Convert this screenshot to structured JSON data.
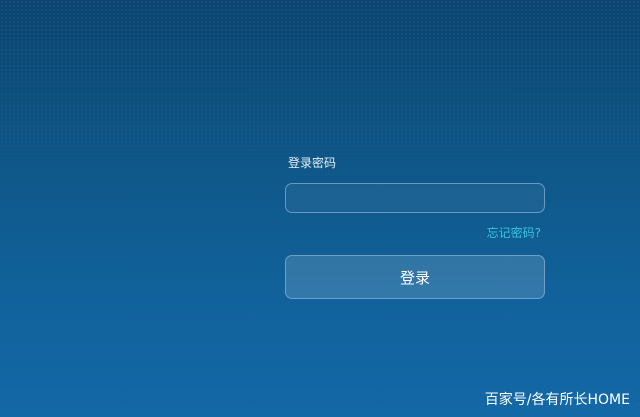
{
  "login": {
    "password_label": "登录密码",
    "password_value": "",
    "forgot_password_label": "忘记密码?",
    "login_button_label": "登录"
  },
  "watermark": {
    "text": "百家号/各有所长HOME"
  },
  "colors": {
    "background_top": "#0b4470",
    "background_bottom": "#1368a6",
    "link": "#36c6e0",
    "text": "#ffffff"
  }
}
